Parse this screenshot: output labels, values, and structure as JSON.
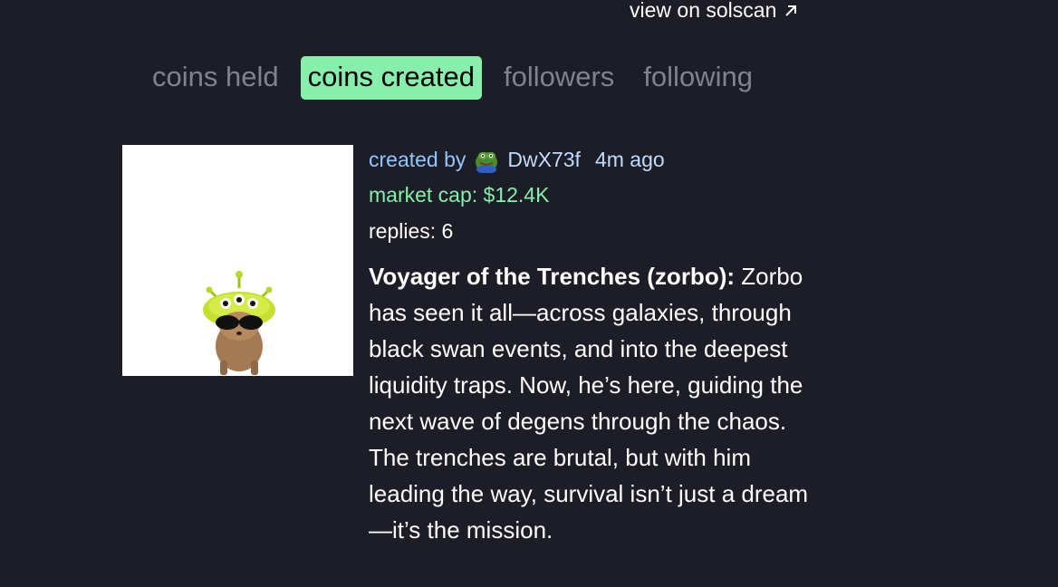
{
  "header": {
    "solscan_label": "view on solscan",
    "solscan_icon": "arrow-up-right-icon"
  },
  "tabs": [
    {
      "label": "coins held",
      "active": false
    },
    {
      "label": "coins created",
      "active": true
    },
    {
      "label": "followers",
      "active": false
    },
    {
      "label": "following",
      "active": false
    }
  ],
  "coin": {
    "created_by_label": "created by",
    "creator": "DwX73f",
    "creator_avatar": "pepe-frog-avatar",
    "time_ago": "4m ago",
    "market_cap": "market cap: $12.4K",
    "replies": "replies: 6",
    "name_line": "Voyager of the Trenches (zorbo):",
    "description": "Zorbo has seen it all—across galaxies, through black swan events, and into the deepest liquidity traps. Now, he’s here, guiding the next wave of degens through the chaos. The trenches are brutal, but with him leading the way, survival isn’t just a dream—it’s the mission.",
    "image": "alien-dog-with-sunglasses"
  },
  "colors": {
    "background": "#1c1d26",
    "active_tab": "#86efac",
    "inactive_tab": "#7f8290",
    "creator_text": "#93c5fd",
    "market_cap": "#86efac"
  }
}
